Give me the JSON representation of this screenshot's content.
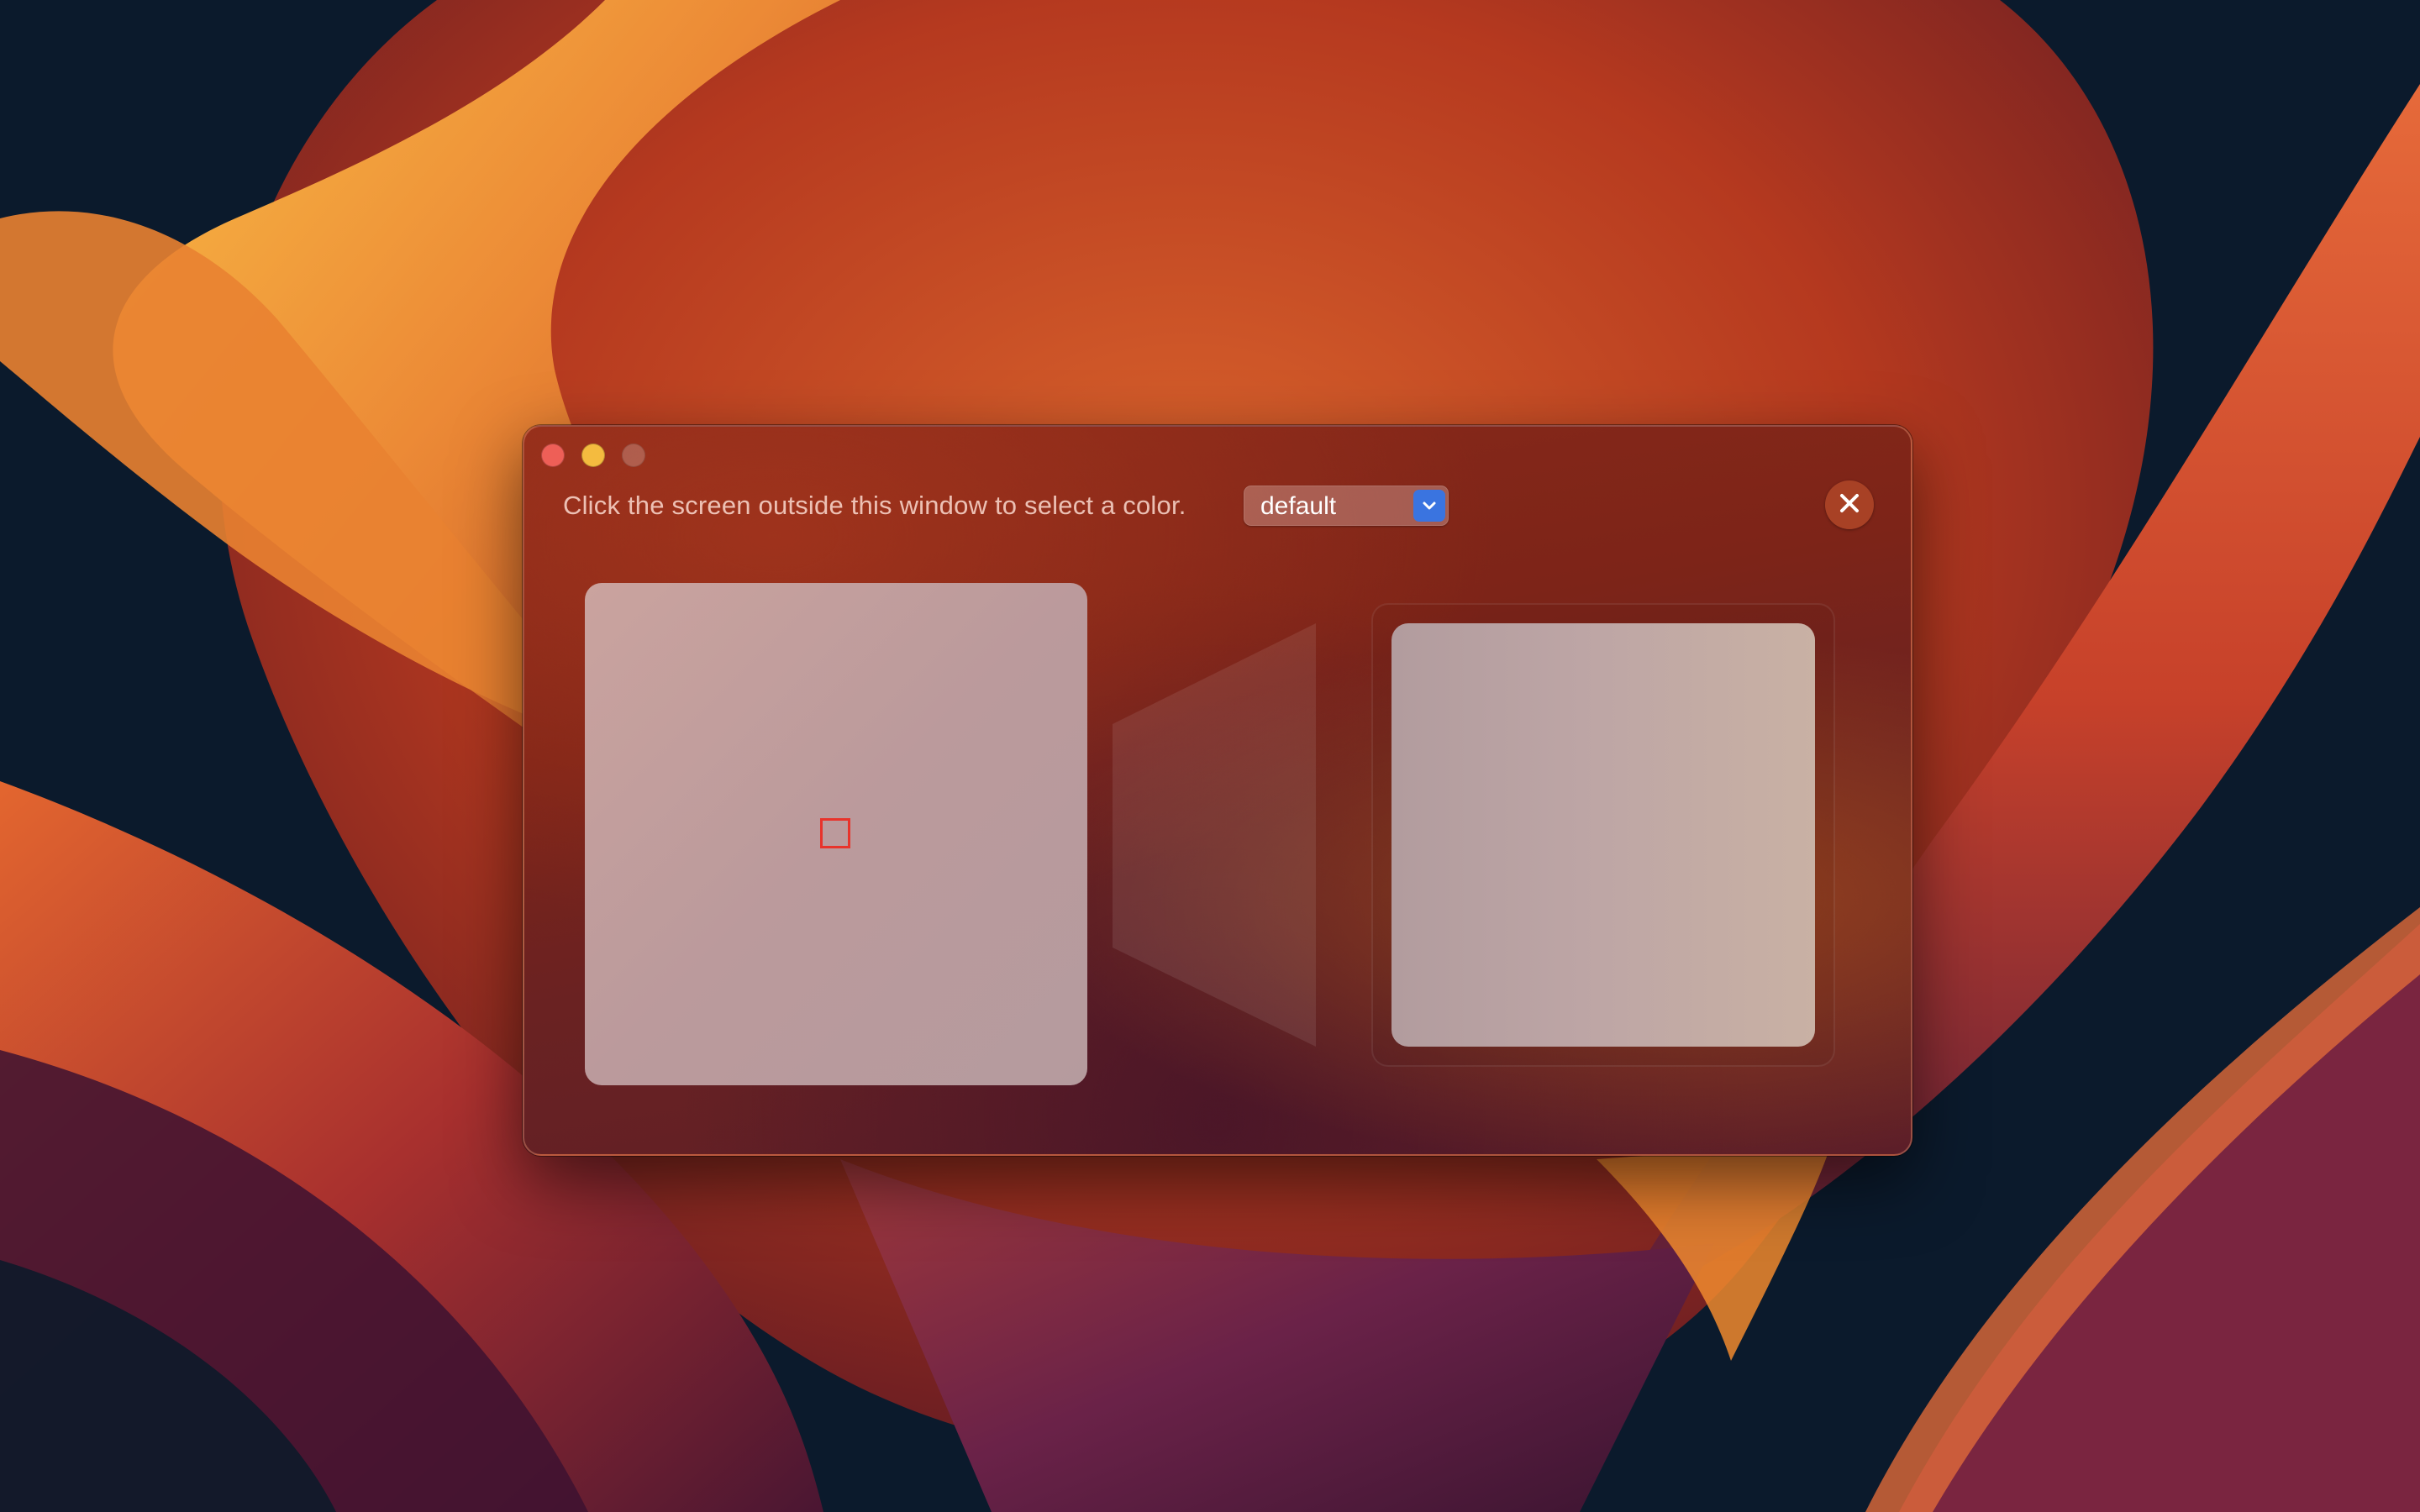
{
  "window": {
    "instruction": "Click the screen outside this window to select a color.",
    "profile_select": {
      "value": "default"
    },
    "close_button_icon": "close-icon"
  },
  "loupe": {
    "reticle_color": "#e8332b"
  },
  "colors": {
    "accent": "#3a74e0",
    "traffic_close": "#ee5f57",
    "traffic_minimize": "#f4bb3f",
    "sampled_color": "#bda5a5"
  }
}
